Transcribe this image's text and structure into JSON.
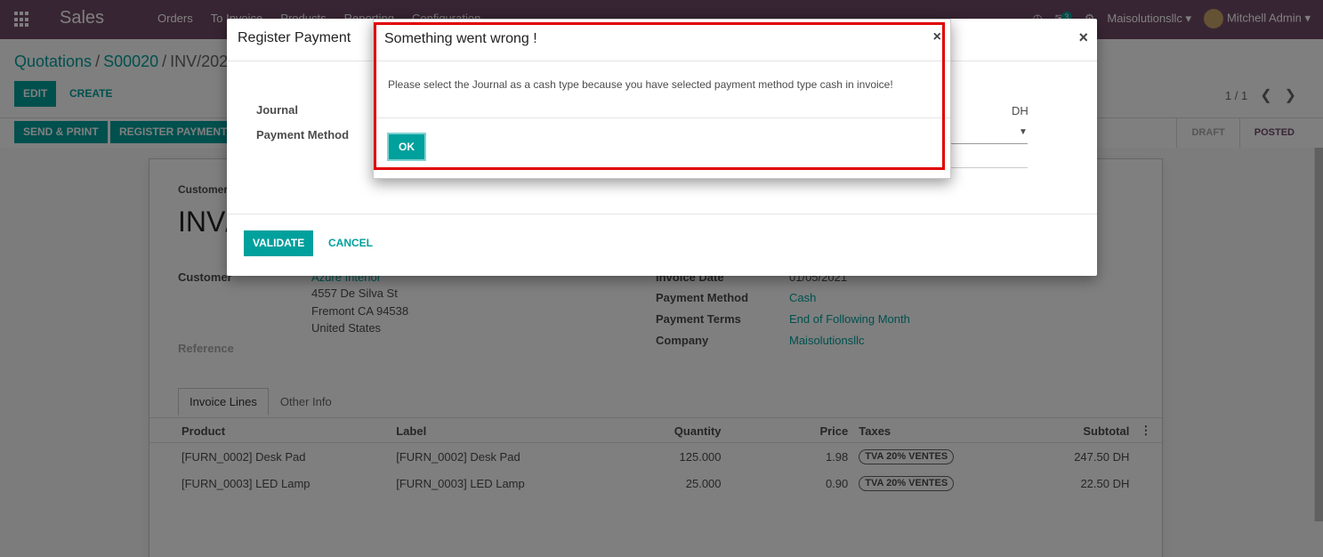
{
  "navbar": {
    "brand": "Sales",
    "menu": [
      "Orders",
      "To Invoice",
      "Products",
      "Reporting",
      "Configuration"
    ],
    "messages_count": "3",
    "company": "Maisolutionsllc",
    "user": "Mitchell Admin"
  },
  "control_panel": {
    "breadcrumb": [
      "Quotations",
      "S00020",
      "INV/2021/0005"
    ],
    "edit_label": "EDIT",
    "create_label": "CREATE",
    "pager": "1 / 1",
    "send_print_label": "SEND & PRINT",
    "register_payment_label": "REGISTER PAYMENT",
    "states": [
      "DRAFT",
      "POSTED"
    ]
  },
  "form": {
    "customer_invoice_label": "Customer Invoice",
    "invoice_title": "INV/2021/0005",
    "customer_label": "Customer",
    "customer_name": "Azure Interior",
    "address": [
      "4557 De Silva St",
      "Fremont CA 94538",
      "United States"
    ],
    "reference_label": "Reference",
    "invoice_date_label": "Invoice Date",
    "invoice_date": "01/05/2021",
    "payment_method_label": "Payment Method",
    "payment_method": "Cash",
    "payment_terms_label": "Payment Terms",
    "payment_terms": "End of Following Month",
    "company_label": "Company",
    "company": "Maisolutionsllc",
    "tabs": [
      "Invoice Lines",
      "Other Info"
    ],
    "columns": [
      "Product",
      "Label",
      "Quantity",
      "Price",
      "Taxes",
      "Subtotal"
    ],
    "rows": [
      {
        "product": "[FURN_0002] Desk Pad",
        "label": "[FURN_0002] Desk Pad",
        "quantity": "125.000",
        "price": "1.98",
        "tax": "TVA 20% VENTES",
        "subtotal": "247.50 DH"
      },
      {
        "product": "[FURN_0003] LED Lamp",
        "label": "[FURN_0003] LED Lamp",
        "quantity": "25.000",
        "price": "0.90",
        "tax": "TVA 20% VENTES",
        "subtotal": "22.50 DH"
      }
    ]
  },
  "register_payment": {
    "title": "Register Payment",
    "journal_label": "Journal",
    "payment_method_label": "Payment Method",
    "currency": "DH",
    "validate_label": "VALIDATE",
    "cancel_label": "CANCEL"
  },
  "error_dialog": {
    "title": "Something went wrong !",
    "message": "Please select the Journal as a cash type because you have selected payment method type cash in invoice!",
    "ok_label": "OK",
    "highlight_color": "#e00000"
  },
  "colors": {
    "primary": "#00a09d",
    "navbar": "#714b67"
  }
}
